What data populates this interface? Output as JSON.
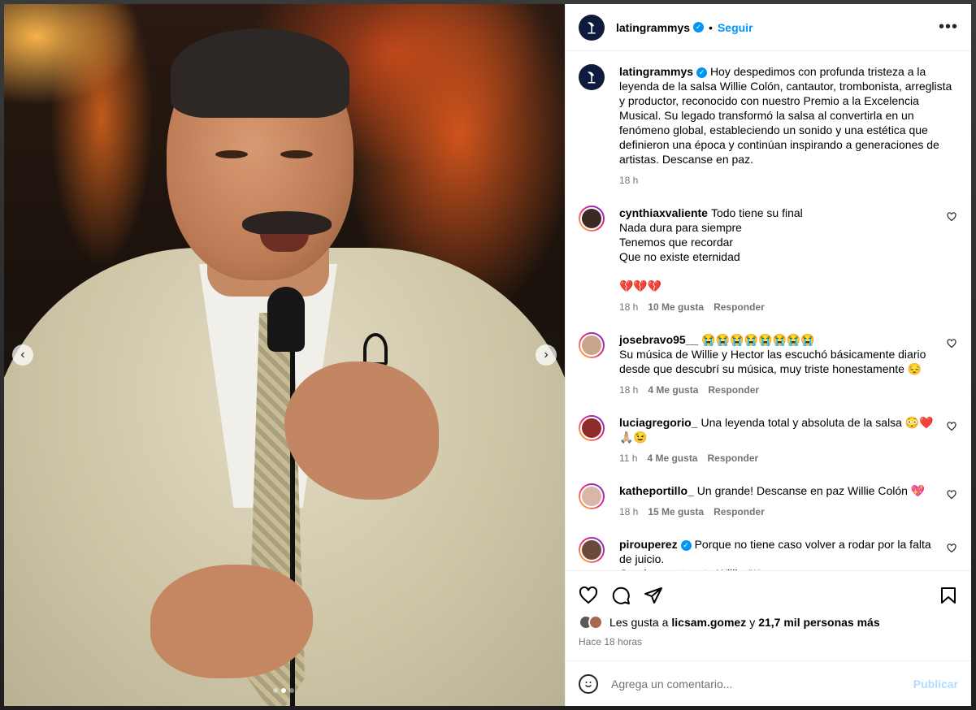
{
  "post": {
    "username": "latingrammys",
    "follow_label": "Seguir",
    "more_label": "•••",
    "caption": "Hoy despedimos con profunda tristeza a la leyenda de la salsa Willie Colón, cantautor, trombonista, arreglista y productor, reconocido con nuestro Premio a la Excelencia Musical. Su legado transformó la salsa al convertirla en un fenómeno global, estableciendo un sonido y una estética que definieron una época y continúan inspirando a generaciones de artistas. Descanse en paz.",
    "caption_time": "18 h",
    "likes_text_prefix": "Les gusta a",
    "likes_user": "licsam.gomez",
    "likes_middle": "y",
    "likes_count": "21,7 mil personas más",
    "posted_ago": "Hace 18 horas"
  },
  "media": {
    "prev_icon": "‹",
    "next_icon": "›",
    "carousel_total": 3,
    "carousel_active": 2
  },
  "comments": [
    {
      "user": "cynthiaxvaliente",
      "text_lines": [
        "Todo tiene su final",
        "Nada dura para siempre",
        "Tenemos que recordar",
        "Que no existe eternidad",
        "",
        "💔💔💔"
      ],
      "time": "18 h",
      "likes": "10 Me gusta",
      "reply": "Responder",
      "verified": false,
      "avatar_color": "#3b2a24"
    },
    {
      "user": "josebravo95__",
      "text_lines": [
        "😭😭😭😭😭😭😭😭",
        "Su música de Willie y Hector las escuchó básicamente diario desde que descubrí su música, muy triste honestamente 😔"
      ],
      "time": "18 h",
      "likes": "4 Me gusta",
      "reply": "Responder",
      "verified": false,
      "avatar_color": "#c9a58b"
    },
    {
      "user": "luciagregorio_",
      "text_lines": [
        "Una leyenda total y absoluta de la salsa 😳❤️ 🙏🏼😉"
      ],
      "time": "11 h",
      "likes": "4 Me gusta",
      "reply": "Responder",
      "verified": false,
      "avatar_color": "#8e2a2a"
    },
    {
      "user": "katheportillo_",
      "text_lines": [
        "Un grande! Descanse en paz Willie Colón 💖"
      ],
      "time": "18 h",
      "likes": "15 Me gusta",
      "reply": "Responder",
      "verified": false,
      "avatar_color": "#d8b7a9"
    },
    {
      "user": "pirouperez",
      "text_lines": [
        "Porque no tiene caso volver a rodar por la falta de juicio.",
        "Gracias por tu arte Willie 🕊️"
      ],
      "time": "",
      "likes": "",
      "reply": "",
      "verified": true,
      "avatar_color": "#6b4a3a"
    }
  ],
  "composer": {
    "placeholder": "Agrega un comentario...",
    "publish_label": "Publicar"
  },
  "colors": {
    "accent": "#0095f6",
    "muted": "#737373"
  }
}
